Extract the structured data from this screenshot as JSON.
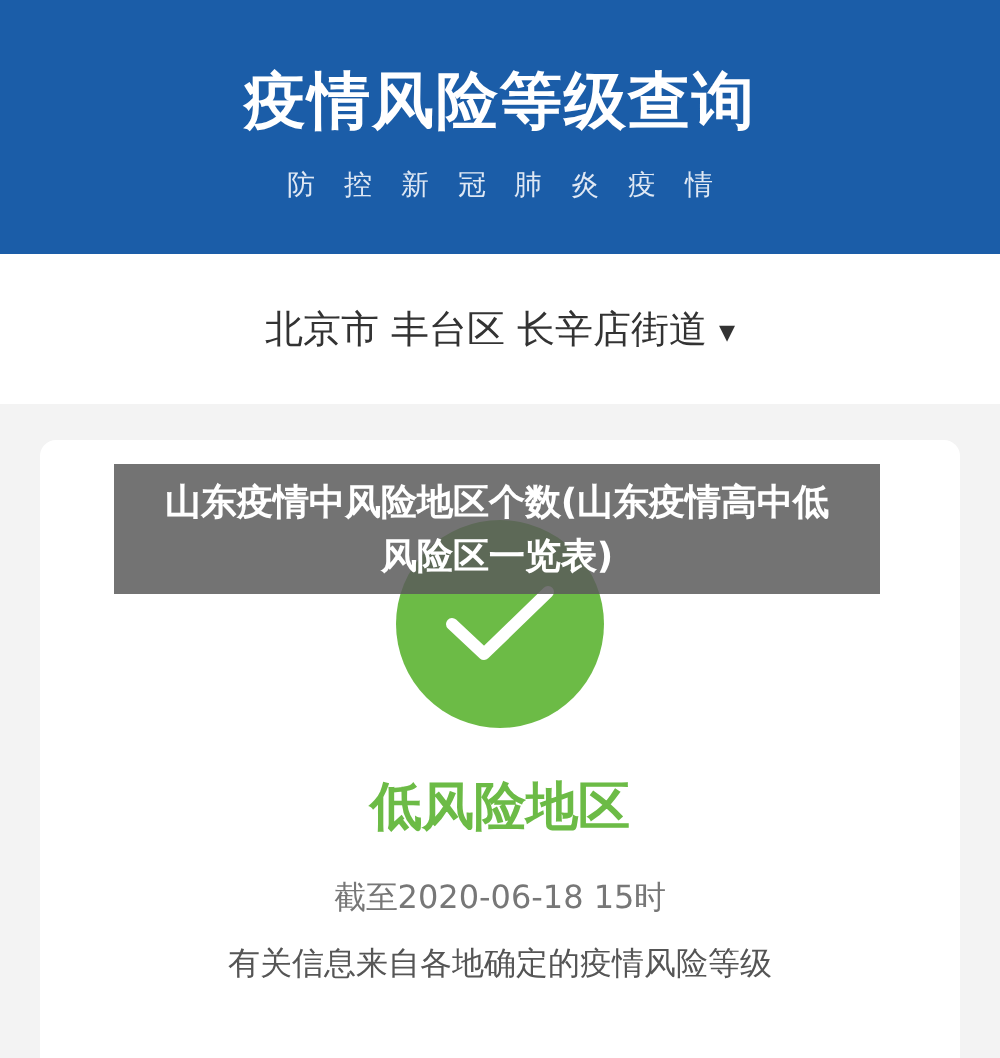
{
  "header": {
    "title": "疫情风险等级查询",
    "subtitle": "防 控 新 冠 肺 炎 疫 情"
  },
  "location": {
    "text": "北京市 丰台区 长辛店街道",
    "caret": "▾"
  },
  "result": {
    "color": "#6cbb46",
    "label": "低风险地区",
    "updated": "截至2020-06-18 15时",
    "source": "有关信息来自各地确定的疫情风险等级"
  },
  "overlay_caption": "山东疫情中风险地区个数(山东疫情高中低风险区一览表)"
}
